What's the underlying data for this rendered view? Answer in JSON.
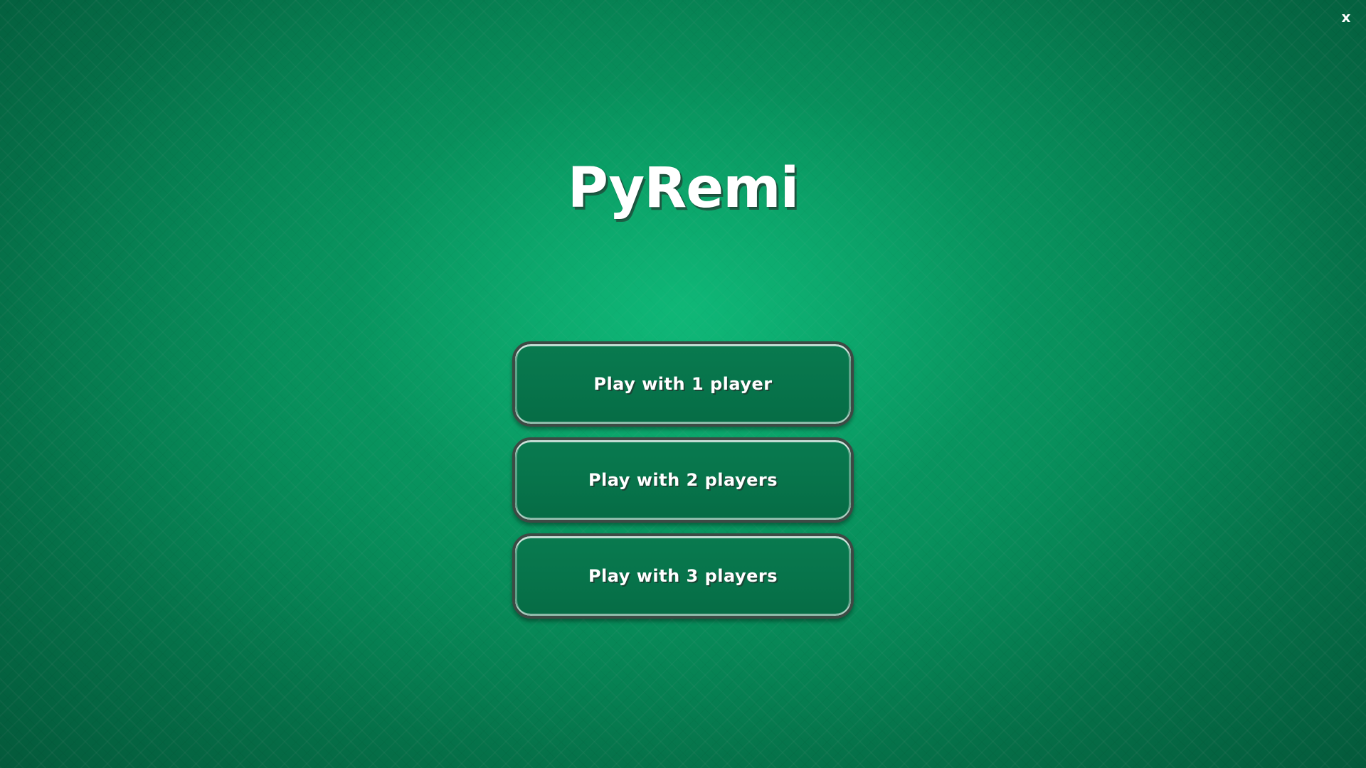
{
  "app": {
    "title": "PyRemi"
  },
  "window": {
    "close_label": "x"
  },
  "menu": {
    "buttons": [
      {
        "label": "Play with 1 player"
      },
      {
        "label": "Play with 2 players"
      },
      {
        "label": "Play with 3 players"
      }
    ]
  },
  "colors": {
    "felt_green": "#0a9a62",
    "button_fill": "#07744b",
    "button_border": "#3c4a44",
    "text": "#ffffff"
  }
}
